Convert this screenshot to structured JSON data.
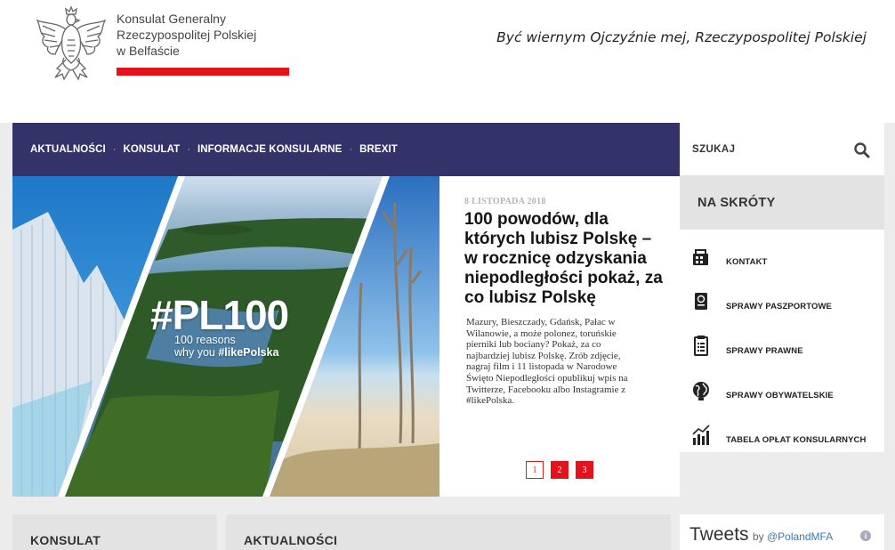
{
  "header": {
    "brand_lines": [
      "Konsulat Generalny",
      "Rzeczypospolitej Polskiej",
      "w Belfaście"
    ],
    "motto": "Być wiernym Ojczyźnie mej, Rzeczypospolitej Polskiej",
    "accent_color": "#e5121b"
  },
  "nav": {
    "items": [
      "AKTUALNOŚCI",
      "KONSULAT",
      "INFORMACJE KONSULARNE",
      "BREXIT"
    ],
    "background": "#33336a"
  },
  "search": {
    "placeholder": "SZUKAJ",
    "icon": "search-icon"
  },
  "hero": {
    "tag": "#PL100",
    "sub_line1": "100 reasons",
    "sub_line2_prefix": "why you ",
    "sub_line2_bold": "#likePolska"
  },
  "article": {
    "date": "8 LISTOPADA 2018",
    "title": "100 powodów, dla których lubisz Polskę – w rocznicę odzyskania niepodległości pokaż, za co lubisz Polskę",
    "body": "Mazury, Bieszczady, Gdańsk, Pałac w Wilanowie, a może polonez, toruńskie pierniki lub bociany? Pokaż, za co najbardziej lubisz Polskę. Zrób zdjęcie, nagraj film i 11 listopada w Narodowe Święto Niepodległości opublikuj wpis na Twitterze, Facebooku albo Instagramie z #likePolska.",
    "pages": [
      "1",
      "2",
      "3"
    ],
    "active_page": "1"
  },
  "quick_links": {
    "title": "NA SKRÓTY",
    "items": [
      {
        "label": "KONTAKT",
        "icon": "contact-icon"
      },
      {
        "label": "SPRAWY PASZPORTOWE",
        "icon": "passport-icon"
      },
      {
        "label": "SPRAWY PRAWNE",
        "icon": "document-icon"
      },
      {
        "label": "SPRAWY OBYWATELSKIE",
        "icon": "globe-icon"
      },
      {
        "label": "TABELA OPŁAT KONSULARNYCH",
        "icon": "chart-icon"
      }
    ]
  },
  "bottom": {
    "panel_left": "KONSULAT",
    "panel_mid": "AKTUALNOŚCI",
    "tweets_title": "Tweets",
    "tweets_by": "by",
    "tweets_handle": "@PolandMFA",
    "tweets_info": "i"
  }
}
